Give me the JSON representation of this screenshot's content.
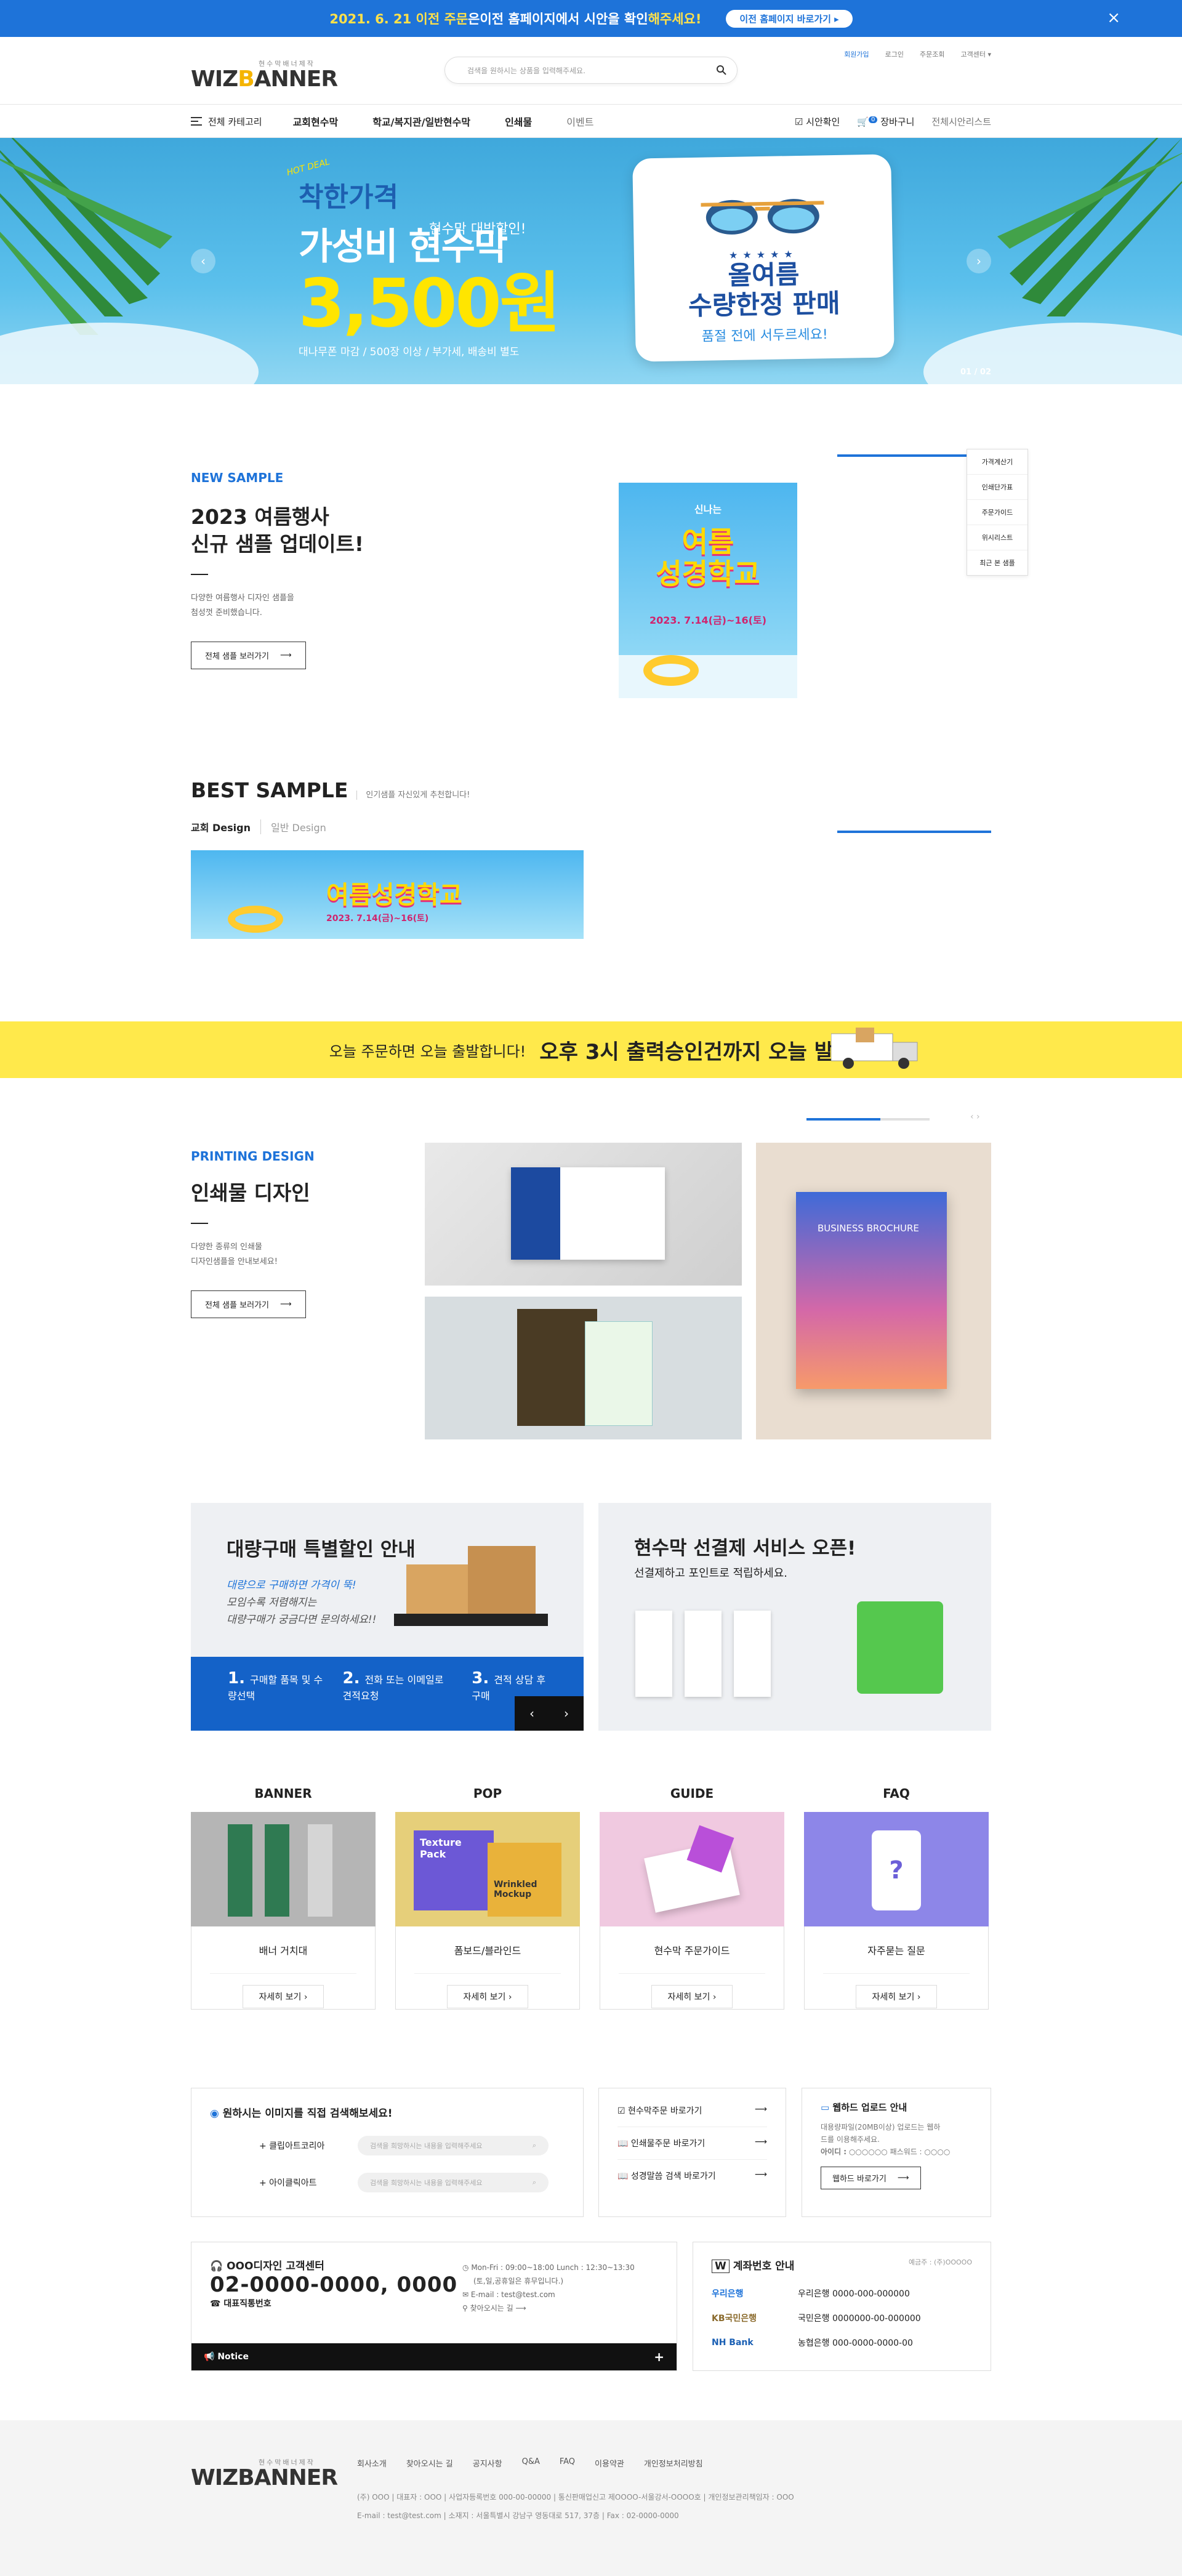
{
  "topbar": {
    "date": "2021. 6. 21 이전 주문",
    "text1": "은 ",
    "bold": "이전 홈페이지에서 시안을 확인",
    "text2": "해주세요!",
    "button": "이전 홈페이지 바로가기 ▸",
    "close": "×"
  },
  "header": {
    "logo_small": "현수막배너제작",
    "logo_a": "WIZ",
    "logo_b": "B",
    "logo_c": "ANNER",
    "search_placeholder": "검색을 원하시는 상품을 입력해주세요.",
    "util": [
      "회원가입",
      "로그인",
      "주문조회",
      "고객센터 ▾"
    ]
  },
  "nav": {
    "category": "전체 카테고리",
    "menu": [
      "교회현수막",
      "학교/복지관/일반현수막",
      "인쇄물",
      "이벤트"
    ],
    "proof": "시안확인",
    "cart": "장바구니",
    "cart_count": "0",
    "wish": "전체시안리스트"
  },
  "hero": {
    "tag": "HOT DEAL",
    "t1": "착한가격",
    "t2": "현수막 대박할인!",
    "t3": "가성비 현수막",
    "price": "3,500원",
    "t5": "대나무폰 마감 / 500장 이상 / 부가세, 배송비 별도",
    "c_stars": "★★★★★",
    "c1": "올여름",
    "c2": "수량한정 판매",
    "c3": "품절 전에 서두르세요!",
    "pager": "01 / 02",
    "prev": "‹",
    "next": "›"
  },
  "new_sample": {
    "eyebrow": "NEW SAMPLE",
    "title1": "2023 여름행사",
    "title2": "신규 샘플 업데이트!",
    "desc1": "다양한 여름행사 디자인 샘플을",
    "desc2": "첨성껏 준비했습니다.",
    "button": "전체 샘플 보러가기",
    "img_title1": "여름",
    "img_title2": "성경학교",
    "img_top": "신나는",
    "img_date": "2023. 7.14(금)~16(토)"
  },
  "quick": [
    "가격계산기",
    "인쇄단가표",
    "주문가이드",
    "위시리스트",
    "최근 본 샘플"
  ],
  "best": {
    "title": "BEST SAMPLE",
    "sub": "인기샘플 자신있게 추천합니다!",
    "tab1": "교회 Design",
    "tab2": "일반 Design",
    "img_title": "여름성경학교",
    "img_date": "2023. 7.14(금)~16(토)"
  },
  "yband": {
    "a": "오늘 주문하면 오늘 출발합니다!",
    "b": "오후 3시 출력승인건까지 오늘 발송"
  },
  "printing": {
    "eyebrow": "PRINTING DESIGN",
    "title": "인쇄물 디자인",
    "desc1": "다양한 종류의 인쇄물",
    "desc2": "디자인샘플을 안내보세요!",
    "button": "전체 샘플 보러가기",
    "brochure": "BUSINESS BROCHURE"
  },
  "promo": {
    "p1_title": "대량구매 특별할인 안내",
    "p1_i1": "대량으로 구매하면 가격이 뚝!",
    "p1_i2": "모임수록 저렴해지는",
    "p1_i3": "대량구매가 궁금다면 문의하세요!!",
    "steps": [
      {
        "n": "1.",
        "t": "구매할 품목 및 수량선택"
      },
      {
        "n": "2.",
        "t": "전화 또는 이메일로 견적요청"
      },
      {
        "n": "3.",
        "t": "견적 상담 후 구매"
      }
    ],
    "prev": "‹",
    "next": "›",
    "p2_title": "현수막 선결제 서비스 오픈!",
    "p2_sub": "선결제하고 포인트로 적립하세요."
  },
  "cards": [
    {
      "title": "BANNER",
      "name": "배너 거치대",
      "btn": "자세히 보기 ›"
    },
    {
      "title": "POP",
      "name": "폼보드/블라인드",
      "btn": "자세히 보기 ›",
      "img_a": "Texture Pack",
      "img_b": "Wrinkled Mockup"
    },
    {
      "title": "GUIDE",
      "name": "현수막 주문가이드",
      "btn": "자세히 보기 ›"
    },
    {
      "title": "FAQ",
      "name": "자주묻는 질문",
      "btn": "자세히 보기 ›"
    }
  ],
  "search_box": {
    "title": "원하시는 이미지를 직접 검색해보세요!",
    "r1": "+ 클립아트코리아",
    "r2": "+ 아이클릭아트",
    "placeholder": "검색을 희망하시는 내용을 입력해주세요"
  },
  "links": [
    "현수막주문 바로가기",
    "인쇄물주문 바로가기",
    "성경말씀 검색 바로가기"
  ],
  "upload": {
    "title": "웹하드 업로드 안내",
    "d1": "대용량파일(20MB이상) 업로드는 웹하",
    "d2": "드를 이용해주세요.",
    "id": "아이디 :",
    "idv": "○○○○○○  패스워드 : ○○○○",
    "btn": "웹하드 바로가기"
  },
  "cs": {
    "title": "OOO디자인 고객센터",
    "phone": "02-0000-0000, 0000",
    "sub": "대표직통번호",
    "h1": "Mon-Fri : 09:00~18:00 Lunch : 12:30~13:30",
    "h2": "(토,일,공휴일은 휴무입니다.)",
    "mail": "E-mail : test@test.com",
    "map": "찾아오시는 길",
    "notice": "Notice",
    "plus": "+"
  },
  "bank": {
    "title": "계좌번호 안내",
    "holder": "예금주 : (주)OOOOO",
    "rows": [
      {
        "b": "우리은행",
        "a": "우리은행 0000-000-000000"
      },
      {
        "b": "KB국민은행",
        "a": "국민은행 0000000-00-000000"
      },
      {
        "b": "NH Bank",
        "a": "농협은행 000-0000-0000-00"
      }
    ]
  },
  "footer": {
    "links": [
      "회사소개",
      "찾아오시는 길",
      "공지사항",
      "Q&A",
      "FAQ",
      "이용약관",
      "개인정보처리방침"
    ],
    "l1": "(주) OOO  |  대표자 : OOO  |  사업자등록번호 000-00-00000  |  통신판매업신고 제OOOO-서울강서-OOOO호  |  개인정보관리책임자 : OOO",
    "l2": "E-mail : test@test.com  |  소재지 : 서울특별시 강남구 영동대로 517, 37층  |  Fax : 02-0000-0000"
  }
}
